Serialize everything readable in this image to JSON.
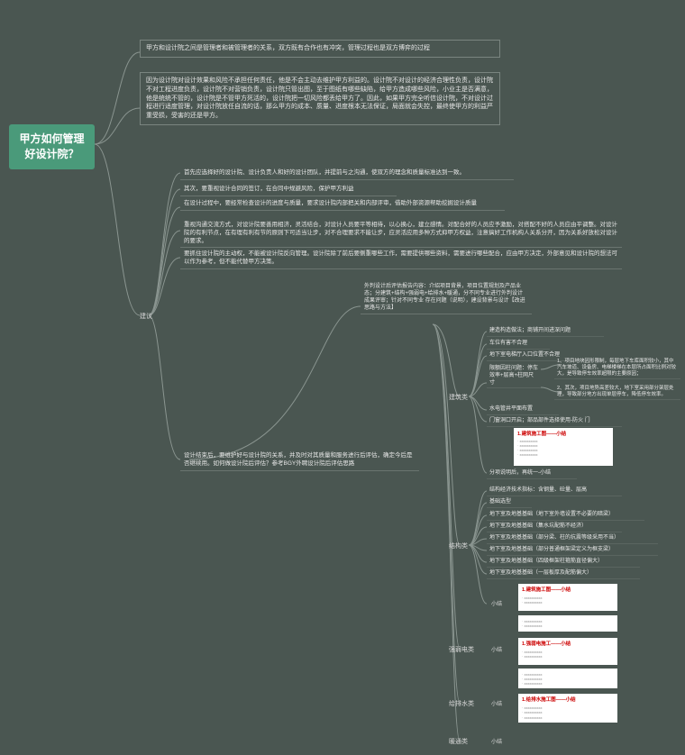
{
  "root": "甲方如何管理好设计院？",
  "p1": "甲方和设计院之间是管理者和被管理者的关系，双方既有合作也有冲突，管理过程也是双方博弈的过程",
  "p2": "因为设计院对设计效果和风险不承担任何责任，他是不会主动去维护甲方利益的。设计院不对设计的经济合理性负责，设计院不对工程进度负责，设计院不对营销负责，设计院只管出图，至于图纸有哪些缺陷，给甲方造成哪些风险，小业主是否满意，他是统统不管的，设计院是不管甲方死活的，设计院把一切风险都丢给甲方了。因此，如果甲方完全听信设计院，不对设计过程进行适度管理，对设计院放任自流的话，那么甲方的成本、质量、进度根本无法保证，局面就会失控，最终使甲方的利益严重受损，受害的还是甲方。",
  "s1": "首先应选择好的设计院、设计负责人和好的设计团队，并提前与之沟通，使双方的理念和质量标准达到一致。",
  "s2": "其次，要重视设计合同的签订，在合同中规避风险，保护甲方利益",
  "s3": "在设计过程中，要经常检查设计的进度与质量，要求设计院内部把关和内部评审，借助外部资源帮助挖掘设计质量",
  "s4": "重视沟通交流方式，对设计院要善用相济，灵活结合，对设计人员要平等相待，以心换心，建立感情。对配合好的人员应予激励，对搭配不好的人员应由平调整。对设计院的有利节点，在有理有利有节的原则下可适当让步，对不合理要求不能让步，应灵活应用多种方式抑甲方权益，注意搞好工作机构人关系分开，因为关系好放松对设计的要求。",
  "s5": "要抓住设计院的主动权，不能被设计院反向管理。设计院除了前后要侧重哪些工作，需要提供哪些资料，需要进行哪些配合，应由甲方决定，外部意见和设计院的想法可以作为参考，但不能代替甲方决策。",
  "adv": "建议",
  "a1": "设计结束后，要维护好与设计院的关系，并及时对其质量和服务进行后评估，确定今后是否继续用。如何做设计院后评估？参考BGY外聘设计院后评估思路",
  "a2": "外判设计后评估报告内容：介绍项目背景，项目位置规划及产品业态；分建筑+结构+强弱电+给排水+暖通，分不同专业进行外判设计成果评审；针对不同专业 存在问题（说明），建设背景与设计【改进思路与方法】",
  "cat_arch": "建筑类",
  "cat_struct": "结构类",
  "cat_elec": "强弱电类",
  "cat_water": "给排水类",
  "cat_hvac": "暖通类",
  "arch": {
    "i1": "建造构造做法；商铺开间进深问题",
    "i2": "车位有害不合理",
    "i3": "地下室电梯厅入口位置不合理",
    "i4": "限额因柱问题：停车效率+层高+柱网尺寸",
    "i4a": "1、项目地块因形限制，每层地下车库面积较小，其中汽车坡道、设备房、电梯楼梯在本层所占面积比例对较大，是导致停车效率超限的主要原因；",
    "i4b": "2、其次，项目地势高差较大，地下室采用部分架层处理，导致部分地方出现单层停车，降低停车效率。",
    "i5": "水电管井平面布置",
    "i6": "门窗洞口开启；部品部件选择使用-防火 门",
    "i7": "分项说明后，再统一-小结"
  },
  "struct": {
    "i1": "结构经济技术指标：含钢量、砼量、层高",
    "i2": "基础选型",
    "i3": "地下室及地基基础（地下室外墙设置不必要的暗梁）",
    "i4": "地下室及地基基础（集水坑配筋不经济）",
    "i5": "地下室及地基基础（部分梁、柱的抗震等级采用不当）",
    "i6": "地下室及地基基础（部分普通框架梁定义为框支梁）",
    "i7": "地下室及地基基础（四级框架柱箍筋直径偏大）",
    "i8": "地下室及地基基础（一层板厚及配筋偏大）",
    "sub": "小结"
  },
  "sub": "小结",
  "doc_hdr": "1.建筑施工图——小结"
}
